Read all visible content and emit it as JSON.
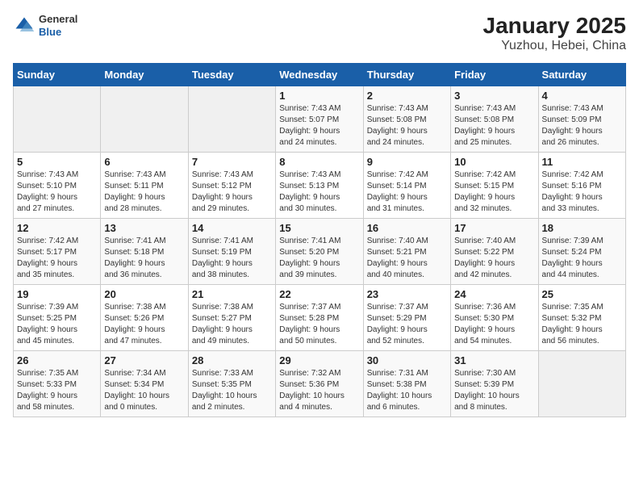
{
  "header": {
    "logo_general": "General",
    "logo_blue": "Blue",
    "title": "January 2025",
    "subtitle": "Yuzhou, Hebei, China"
  },
  "weekdays": [
    "Sunday",
    "Monday",
    "Tuesday",
    "Wednesday",
    "Thursday",
    "Friday",
    "Saturday"
  ],
  "weeks": [
    [
      {
        "num": "",
        "detail": ""
      },
      {
        "num": "",
        "detail": ""
      },
      {
        "num": "",
        "detail": ""
      },
      {
        "num": "1",
        "detail": "Sunrise: 7:43 AM\nSunset: 5:07 PM\nDaylight: 9 hours\nand 24 minutes."
      },
      {
        "num": "2",
        "detail": "Sunrise: 7:43 AM\nSunset: 5:08 PM\nDaylight: 9 hours\nand 24 minutes."
      },
      {
        "num": "3",
        "detail": "Sunrise: 7:43 AM\nSunset: 5:08 PM\nDaylight: 9 hours\nand 25 minutes."
      },
      {
        "num": "4",
        "detail": "Sunrise: 7:43 AM\nSunset: 5:09 PM\nDaylight: 9 hours\nand 26 minutes."
      }
    ],
    [
      {
        "num": "5",
        "detail": "Sunrise: 7:43 AM\nSunset: 5:10 PM\nDaylight: 9 hours\nand 27 minutes."
      },
      {
        "num": "6",
        "detail": "Sunrise: 7:43 AM\nSunset: 5:11 PM\nDaylight: 9 hours\nand 28 minutes."
      },
      {
        "num": "7",
        "detail": "Sunrise: 7:43 AM\nSunset: 5:12 PM\nDaylight: 9 hours\nand 29 minutes."
      },
      {
        "num": "8",
        "detail": "Sunrise: 7:43 AM\nSunset: 5:13 PM\nDaylight: 9 hours\nand 30 minutes."
      },
      {
        "num": "9",
        "detail": "Sunrise: 7:42 AM\nSunset: 5:14 PM\nDaylight: 9 hours\nand 31 minutes."
      },
      {
        "num": "10",
        "detail": "Sunrise: 7:42 AM\nSunset: 5:15 PM\nDaylight: 9 hours\nand 32 minutes."
      },
      {
        "num": "11",
        "detail": "Sunrise: 7:42 AM\nSunset: 5:16 PM\nDaylight: 9 hours\nand 33 minutes."
      }
    ],
    [
      {
        "num": "12",
        "detail": "Sunrise: 7:42 AM\nSunset: 5:17 PM\nDaylight: 9 hours\nand 35 minutes."
      },
      {
        "num": "13",
        "detail": "Sunrise: 7:41 AM\nSunset: 5:18 PM\nDaylight: 9 hours\nand 36 minutes."
      },
      {
        "num": "14",
        "detail": "Sunrise: 7:41 AM\nSunset: 5:19 PM\nDaylight: 9 hours\nand 38 minutes."
      },
      {
        "num": "15",
        "detail": "Sunrise: 7:41 AM\nSunset: 5:20 PM\nDaylight: 9 hours\nand 39 minutes."
      },
      {
        "num": "16",
        "detail": "Sunrise: 7:40 AM\nSunset: 5:21 PM\nDaylight: 9 hours\nand 40 minutes."
      },
      {
        "num": "17",
        "detail": "Sunrise: 7:40 AM\nSunset: 5:22 PM\nDaylight: 9 hours\nand 42 minutes."
      },
      {
        "num": "18",
        "detail": "Sunrise: 7:39 AM\nSunset: 5:24 PM\nDaylight: 9 hours\nand 44 minutes."
      }
    ],
    [
      {
        "num": "19",
        "detail": "Sunrise: 7:39 AM\nSunset: 5:25 PM\nDaylight: 9 hours\nand 45 minutes."
      },
      {
        "num": "20",
        "detail": "Sunrise: 7:38 AM\nSunset: 5:26 PM\nDaylight: 9 hours\nand 47 minutes."
      },
      {
        "num": "21",
        "detail": "Sunrise: 7:38 AM\nSunset: 5:27 PM\nDaylight: 9 hours\nand 49 minutes."
      },
      {
        "num": "22",
        "detail": "Sunrise: 7:37 AM\nSunset: 5:28 PM\nDaylight: 9 hours\nand 50 minutes."
      },
      {
        "num": "23",
        "detail": "Sunrise: 7:37 AM\nSunset: 5:29 PM\nDaylight: 9 hours\nand 52 minutes."
      },
      {
        "num": "24",
        "detail": "Sunrise: 7:36 AM\nSunset: 5:30 PM\nDaylight: 9 hours\nand 54 minutes."
      },
      {
        "num": "25",
        "detail": "Sunrise: 7:35 AM\nSunset: 5:32 PM\nDaylight: 9 hours\nand 56 minutes."
      }
    ],
    [
      {
        "num": "26",
        "detail": "Sunrise: 7:35 AM\nSunset: 5:33 PM\nDaylight: 9 hours\nand 58 minutes."
      },
      {
        "num": "27",
        "detail": "Sunrise: 7:34 AM\nSunset: 5:34 PM\nDaylight: 10 hours\nand 0 minutes."
      },
      {
        "num": "28",
        "detail": "Sunrise: 7:33 AM\nSunset: 5:35 PM\nDaylight: 10 hours\nand 2 minutes."
      },
      {
        "num": "29",
        "detail": "Sunrise: 7:32 AM\nSunset: 5:36 PM\nDaylight: 10 hours\nand 4 minutes."
      },
      {
        "num": "30",
        "detail": "Sunrise: 7:31 AM\nSunset: 5:38 PM\nDaylight: 10 hours\nand 6 minutes."
      },
      {
        "num": "31",
        "detail": "Sunrise: 7:30 AM\nSunset: 5:39 PM\nDaylight: 10 hours\nand 8 minutes."
      },
      {
        "num": "",
        "detail": ""
      }
    ]
  ]
}
